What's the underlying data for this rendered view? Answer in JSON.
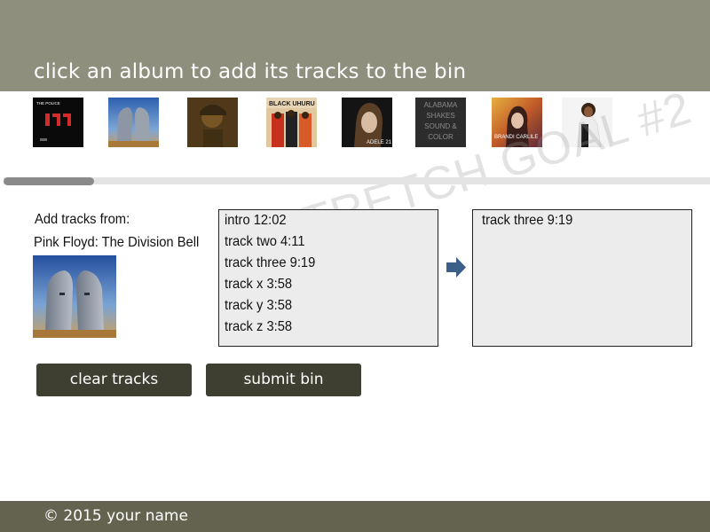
{
  "header": {
    "title": "click an album to add its tracks to the bin"
  },
  "albums": [
    {
      "text": "THE POLICE",
      "art": "18 1",
      "accent": "#cc2222"
    },
    {
      "text": "",
      "art": "",
      "accent": "#3a73c0"
    },
    {
      "text": "",
      "art": "",
      "accent": "#c9a04a"
    },
    {
      "text": "BLACK UHURU",
      "art": "",
      "accent": "#d8442a"
    },
    {
      "text": "ADELE 21",
      "art": "",
      "accent": "#222222"
    },
    {
      "text": "ALABAMA SHAKES SOUND & COLOR",
      "art": "",
      "accent": "#444444"
    },
    {
      "text": "BRANDI CARLILE",
      "art": "",
      "accent": "#e07a2a"
    },
    {
      "text": "",
      "art": "",
      "accent": "#ffffff"
    }
  ],
  "watermark": "STRETCH GOAL #2",
  "source": {
    "label": "Add tracks from:",
    "album": "Pink Floyd: The Division Bell"
  },
  "tracks": [
    "intro 12:02",
    "track two 4:11",
    "track three 9:19",
    "track x 3:58",
    "track y 3:58",
    "track z 3:58"
  ],
  "bin": [
    "track three 9:19"
  ],
  "buttons": {
    "clear": "clear tracks",
    "submit": "submit bin"
  },
  "footer": {
    "text": "©  2015 your name"
  },
  "colors": {
    "header": "#8f8f7e",
    "footer": "#63634f",
    "button": "#3e3e31",
    "arrow": "#3c5f8a"
  }
}
